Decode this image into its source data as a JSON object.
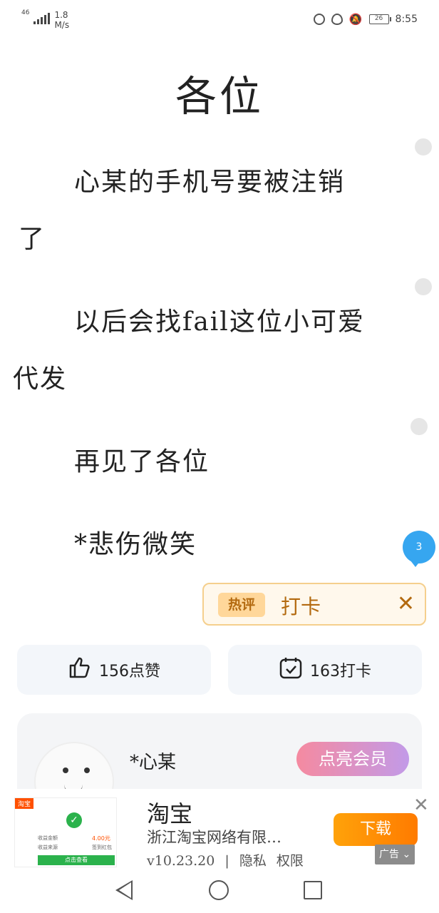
{
  "status_bar": {
    "network_type": "46",
    "speed_value": "1.8",
    "speed_unit": "M/s",
    "battery": "26",
    "time": "8:55"
  },
  "post": {
    "title": "各位",
    "paragraphs": [
      {
        "line1": "心某的手机号要被注销",
        "line2": "了"
      },
      {
        "line1": "以后会找fail这位小可爱",
        "line2": "代发"
      },
      {
        "line1": "再见了各位"
      },
      {
        "line1": "*悲伤微笑"
      }
    ]
  },
  "comment_badge": "3",
  "hot_popup": {
    "tag": "热评",
    "text": "打卡",
    "close": "✕"
  },
  "stats": {
    "like_label": "156点赞",
    "checkin_label": "163打卡"
  },
  "profile": {
    "username": "*心某",
    "vip_button": "点亮会员"
  },
  "ad": {
    "app_name": "淘宝",
    "company": "浙江淘宝网络有限…",
    "version": "v10.23.20",
    "divider": "|",
    "privacy": "隐私",
    "permission": "权限",
    "download": "下载",
    "ad_label": "广告",
    "close": "✕",
    "thumb": {
      "tag": "淘宝",
      "row1": "收益金额",
      "row2": "收益来源",
      "amount": "4.00元",
      "source": "签到红包",
      "button": "点击查看"
    }
  },
  "icons": {
    "like": "thumbs-up-icon",
    "checkin": "calendar-check-icon",
    "back": "back-triangle-icon",
    "home": "home-circle-icon",
    "recent": "recent-square-icon"
  }
}
